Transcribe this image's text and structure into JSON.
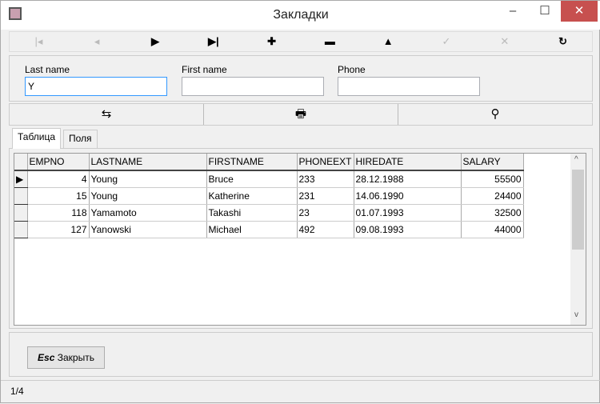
{
  "window": {
    "title": "Закладки",
    "minimize": "‒",
    "maximize": "☐",
    "close": "✕"
  },
  "toolbar": [
    {
      "name": "first-record",
      "glyph": "|◂",
      "disabled": true
    },
    {
      "name": "prior-record",
      "glyph": "◂",
      "disabled": true
    },
    {
      "name": "next-record",
      "glyph": "▶",
      "disabled": false
    },
    {
      "name": "last-record",
      "glyph": "▶|",
      "disabled": false
    },
    {
      "name": "insert-record",
      "glyph": "✚",
      "disabled": false
    },
    {
      "name": "delete-record",
      "glyph": "▬",
      "disabled": false
    },
    {
      "name": "edit-record",
      "glyph": "▲",
      "disabled": false
    },
    {
      "name": "post-record",
      "glyph": "✓",
      "disabled": true
    },
    {
      "name": "cancel-record",
      "glyph": "✕",
      "disabled": true
    },
    {
      "name": "refresh",
      "glyph": "↻",
      "disabled": false
    }
  ],
  "search": {
    "last_name_label": "Last name",
    "last_name_value": "Y",
    "first_name_label": "First name",
    "first_name_value": "",
    "phone_label": "Phone",
    "phone_value": ""
  },
  "actions": [
    {
      "name": "bookmark",
      "glyph": "⇆"
    },
    {
      "name": "print",
      "glyph": "🖶"
    },
    {
      "name": "find",
      "glyph": "⚲"
    }
  ],
  "tabs": [
    "Таблица",
    "Поля"
  ],
  "grid": {
    "columns": [
      "EMPNO",
      "LASTNAME",
      "FIRSTNAME",
      "PHONEEXT",
      "HIREDATE",
      "SALARY"
    ],
    "rows": [
      [
        "4",
        "Young",
        "Bruce",
        "233",
        "28.12.1988",
        "55500"
      ],
      [
        "15",
        "Young",
        "Katherine",
        "231",
        "14.06.1990",
        "24400"
      ],
      [
        "118",
        "Yamamoto",
        "Takashi",
        "23",
        "01.07.1993",
        "32500"
      ],
      [
        "127",
        "Yanowski",
        "Michael",
        "492",
        "09.08.1993",
        "44000"
      ]
    ]
  },
  "close_button": {
    "key": "Esc",
    "label": "Закрыть"
  },
  "status": "1/4"
}
